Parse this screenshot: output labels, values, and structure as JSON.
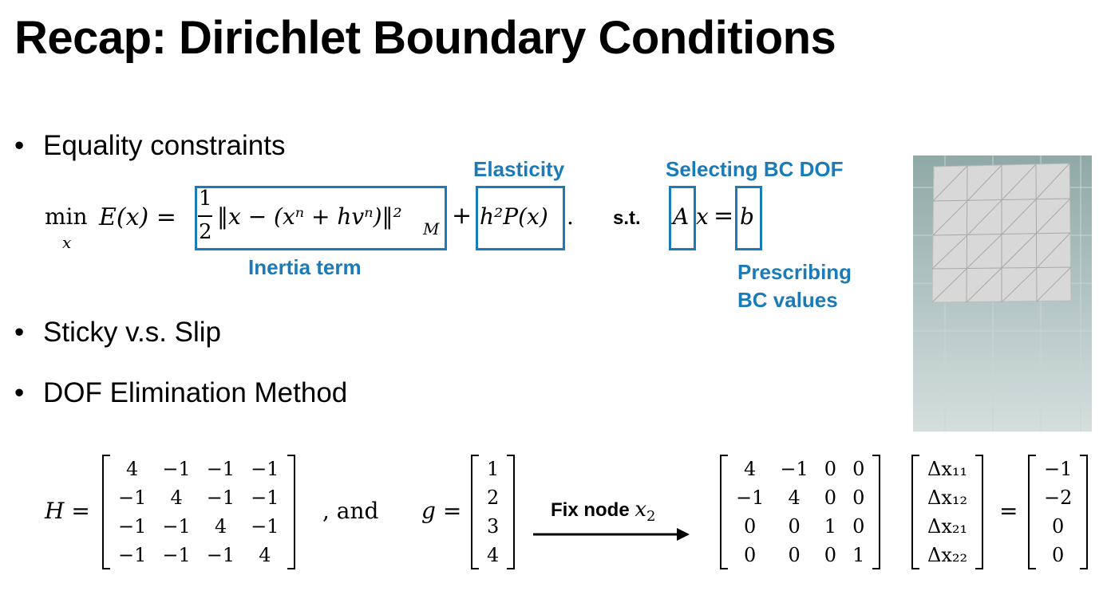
{
  "title": "Recap: Dirichlet Boundary Conditions",
  "bullets": [
    "Equality constraints",
    "Sticky v.s. Slip",
    "DOF Elimination Method"
  ],
  "annotations": {
    "elasticity": "Elasticity",
    "selecting": "Selecting BC DOF",
    "inertia": "Inertia term",
    "prescribing_1": "Prescribing",
    "prescribing_2": "BC values"
  },
  "equation": {
    "min": "min",
    "sub": "x",
    "lhs": "E(x) =",
    "half_num": "1",
    "half_den": "2",
    "inertia": "‖x − (xⁿ + hvⁿ)‖²",
    "inertia_sub": "M",
    "plus": "+",
    "elastic": "h²P(x)",
    "period": ".",
    "st": "s.t.",
    "A": "A",
    "x": "x",
    "eq": "=",
    "b": "b"
  },
  "bottom": {
    "H_label": "H =",
    "and": ",    and",
    "g_label": "g =",
    "arrow_label": "Fix node",
    "arrow_var": "x",
    "arrow_sub": "2",
    "equals": "=",
    "H": [
      [
        "4",
        "−1",
        "−1",
        "−1"
      ],
      [
        "−1",
        "4",
        "−1",
        "−1"
      ],
      [
        "−1",
        "−1",
        "4",
        "−1"
      ],
      [
        "−1",
        "−1",
        "−1",
        "4"
      ]
    ],
    "g": [
      "1",
      "2",
      "3",
      "4"
    ],
    "H2": [
      [
        "4",
        "−1",
        "0",
        "0"
      ],
      [
        "−1",
        "4",
        "0",
        "0"
      ],
      [
        "0",
        "0",
        "1",
        "0"
      ],
      [
        "0",
        "0",
        "0",
        "1"
      ]
    ],
    "dx": [
      "Δx₁₁",
      "Δx₁₂",
      "Δx₂₁",
      "Δx₂₂"
    ],
    "rhs": [
      "−1",
      "−2",
      "0",
      "0"
    ]
  },
  "colors": {
    "accent": "#1a7bb8"
  }
}
